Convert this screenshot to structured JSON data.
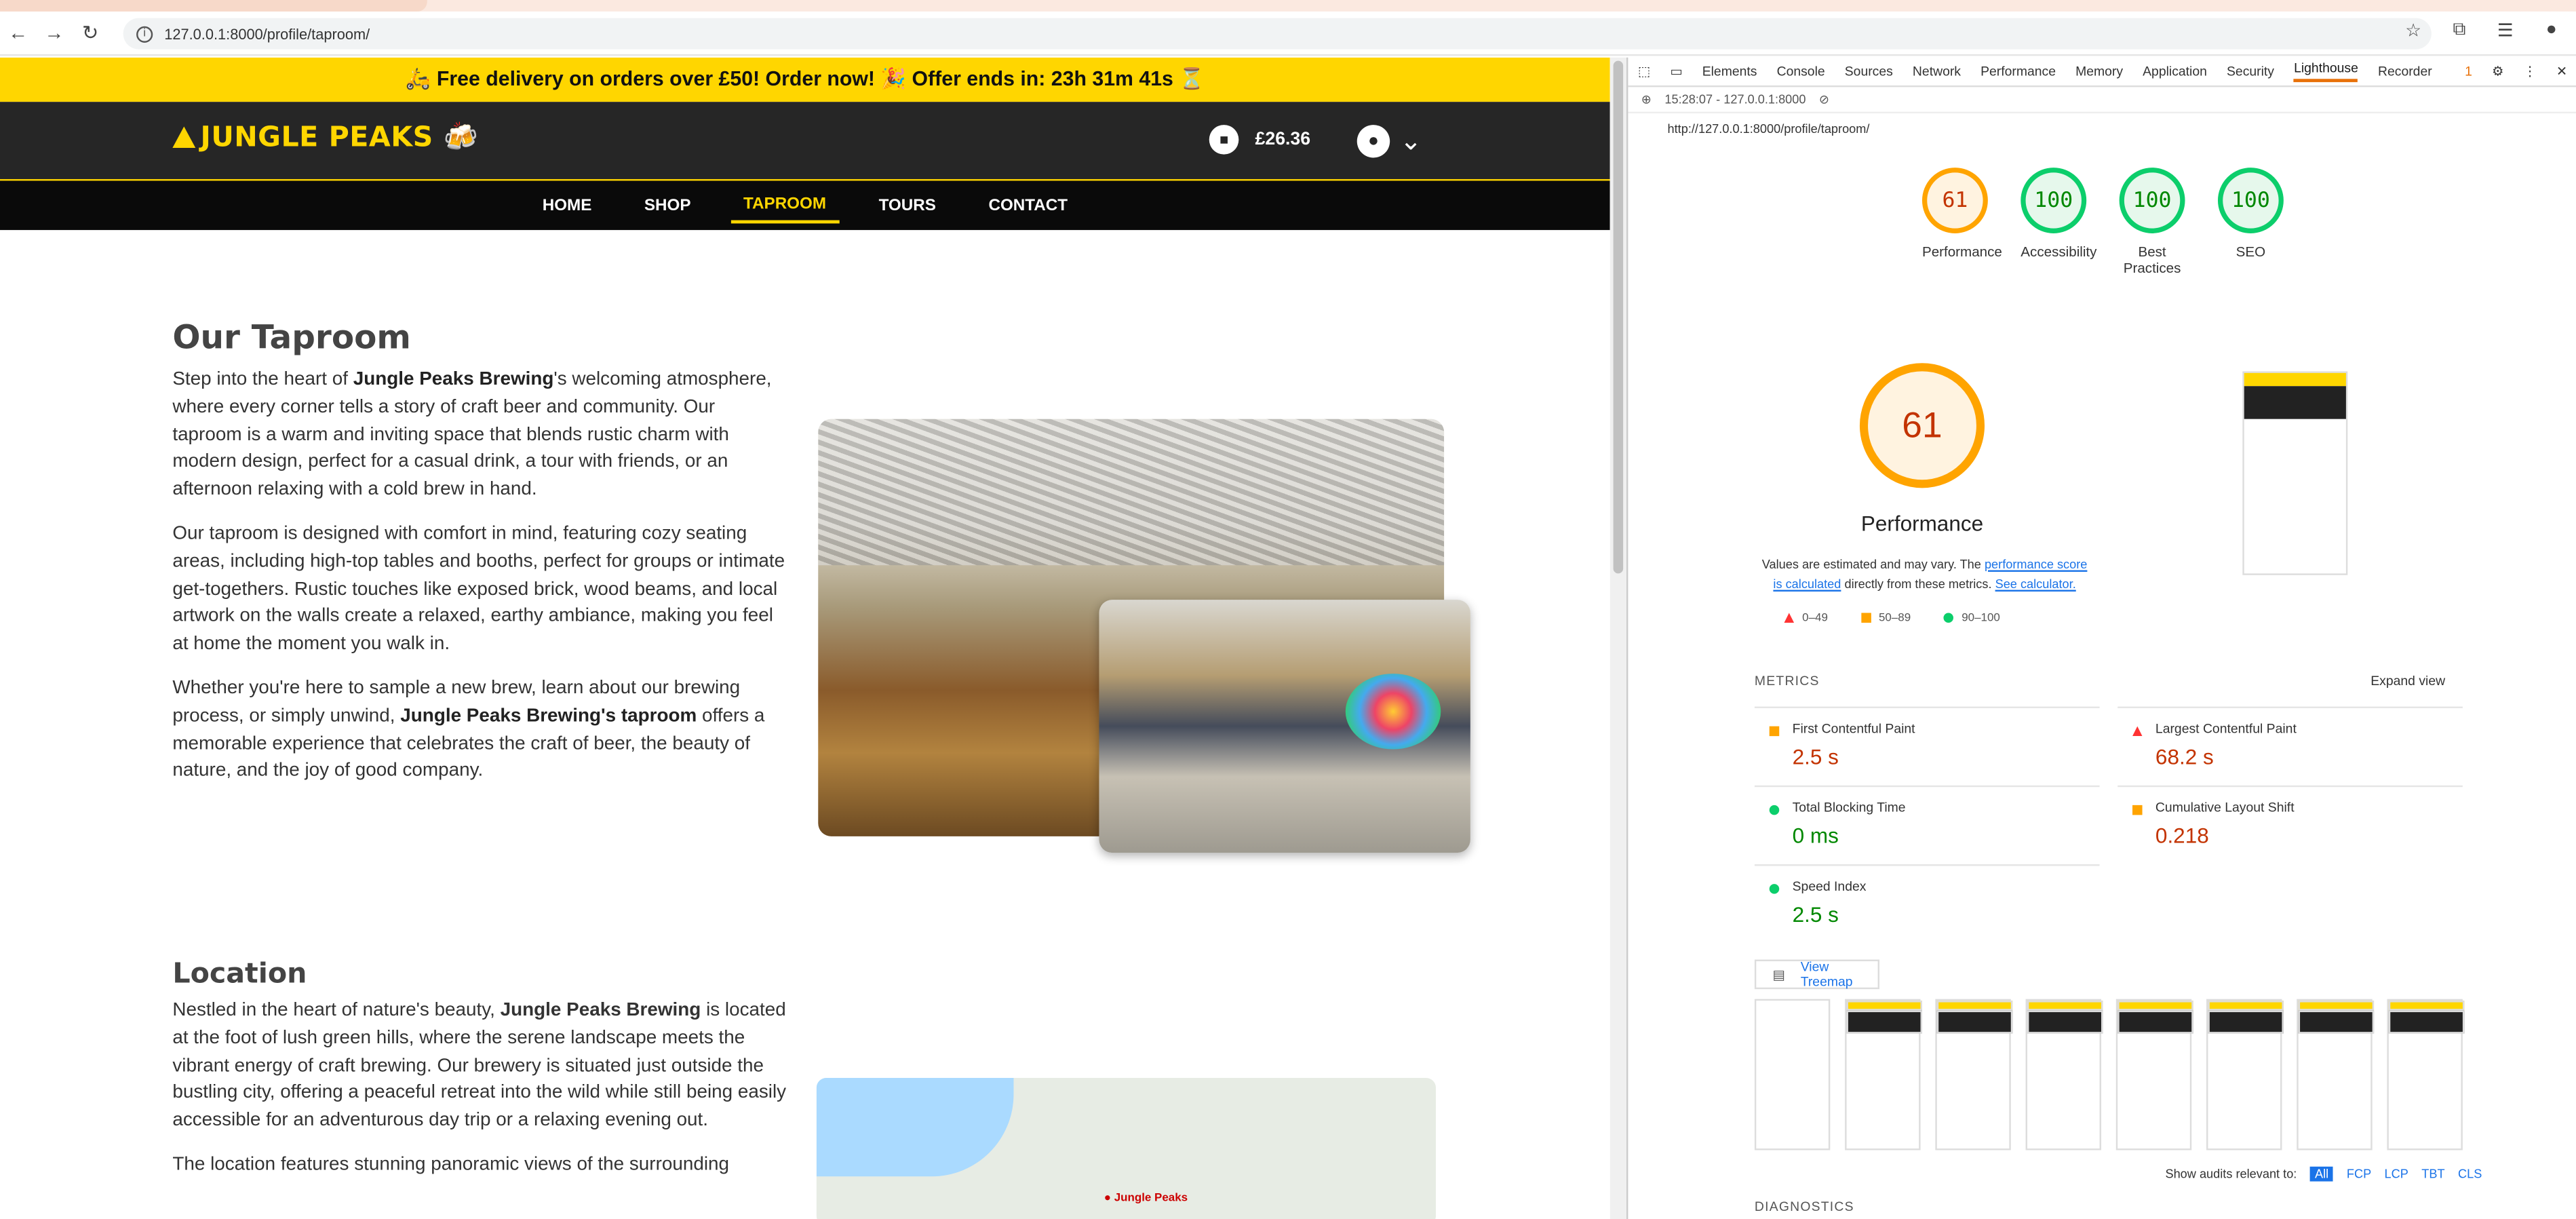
{
  "browser": {
    "url": "127.0.0.1:8000/profile/taproom/"
  },
  "promo": {
    "text": "🛵 Free delivery on orders over £50! Order now! 🎉 Offer ends in: 23h 31m 41s ⏳"
  },
  "site": {
    "logo": "JUNGLE PEAKS 🍻",
    "cart_total": "£26.36",
    "nav": [
      "HOME",
      "SHOP",
      "TAPROOM",
      "TOURS",
      "CONTACT"
    ],
    "taproom": {
      "title": "Our Taproom",
      "p1": {
        "a": "Step into the heart of ",
        "b": "Jungle Peaks Brewing",
        "c": "'s welcoming atmosphere, where every corner tells a story of craft beer and community. Our taproom is a warm and inviting space that blends rustic charm with modern design, perfect for a casual drink, a tour with friends, or an afternoon relaxing with a cold brew in hand."
      },
      "p2": "Our taproom is designed with comfort in mind, featuring cozy seating areas, including high-top tables and booths, perfect for groups or intimate get-togethers. Rustic touches like exposed brick, wood beams, and local artwork on the walls create a relaxed, earthy ambiance, making you feel at home the moment you walk in.",
      "p3": {
        "a": "Whether you're here to sample a new brew, learn about our brewing process, or simply unwind, ",
        "b": "Jungle Peaks Brewing's taproom",
        "c": " offers a memorable experience that celebrates the craft of beer, the beauty of nature, and the joy of good company."
      }
    },
    "location": {
      "title": "Location",
      "p1": {
        "a": "Nestled in the heart of nature's beauty, ",
        "b": "Jungle Peaks Brewing",
        "c": " is located at the foot of lush green hills, where the serene landscape meets the vibrant energy of craft brewing. Our brewery is situated just outside the bustling city, offering a peaceful retreat into the wild while still being easily accessible for an adventurous day trip or a relaxing evening out."
      },
      "p2": "The location features stunning panoramic views of the surrounding"
    },
    "map_pin": "Jungle Peaks"
  },
  "devtools": {
    "tabs": [
      "Elements",
      "Console",
      "Sources",
      "Network",
      "Performance",
      "Memory",
      "Application",
      "Security",
      "Lighthouse",
      "Recorder"
    ],
    "issues": "1",
    "report_time": "15:28:07 - 127.0.0.1:8000",
    "report_url": "http://127.0.0.1:8000/profile/taproom/",
    "gauges": [
      {
        "score": "61",
        "label": "Performance"
      },
      {
        "score": "100",
        "label": "Accessibility"
      },
      {
        "score": "100",
        "label": "Best Practices"
      },
      {
        "score": "100",
        "label": "SEO"
      }
    ],
    "perf_score": "61",
    "perf_label": "Performance",
    "values_text": {
      "a": "Values are estimated and may vary. The ",
      "link": "performance score is calculated",
      "b": " directly from these metrics. ",
      "link2": "See calculator."
    },
    "legend": [
      "0–49",
      "50–89",
      "90–100"
    ],
    "metrics_header": "METRICS",
    "expand": "Expand view",
    "metrics": [
      {
        "name": "First Contentful Paint",
        "value": "2.5 s",
        "color": "#c33300"
      },
      {
        "name": "Largest Contentful Paint",
        "value": "68.2 s",
        "color": "#c33300"
      },
      {
        "name": "Total Blocking Time",
        "value": "0 ms",
        "color": "#008800"
      },
      {
        "name": "Cumulative Layout Shift",
        "value": "0.218",
        "color": "#c33300"
      },
      {
        "name": "Speed Index",
        "value": "2.5 s",
        "color": "#008800"
      }
    ],
    "treemap": "View Treemap",
    "show_audits": "Show audits relevant to:",
    "audit_filters": [
      "All",
      "FCP",
      "LCP",
      "TBT",
      "CLS"
    ],
    "diagnostics": "DIAGNOSTICS"
  }
}
